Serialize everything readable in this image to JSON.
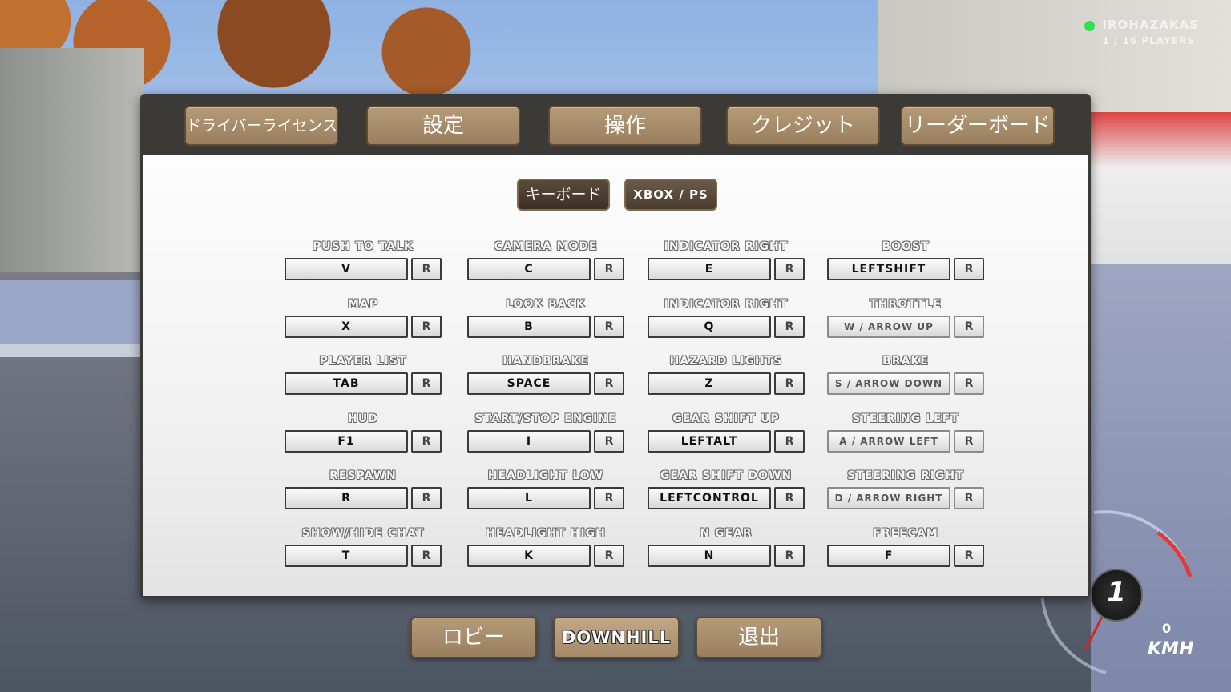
{
  "hud": {
    "server_name": "IROHAZAKAS",
    "players": "1 / 16 PLAYERS",
    "gear": "1",
    "speed": "0",
    "speed_unit": "KMH",
    "status_color": "#2ee04a"
  },
  "tabs": [
    {
      "label": "ドライバーライセンス",
      "active": false
    },
    {
      "label": "設定",
      "active": false
    },
    {
      "label": "操作",
      "active": true
    },
    {
      "label": "クレジット",
      "active": false
    },
    {
      "label": "リーダーボード",
      "active": false
    }
  ],
  "device_toggle": {
    "keyboard": "キーボード",
    "gamepad": "XBOX / PS",
    "selected": "keyboard"
  },
  "reset_label": "R",
  "bindings": [
    [
      {
        "action": "PUSH TO TALK",
        "key": "V"
      },
      {
        "action": "MAP",
        "key": "X"
      },
      {
        "action": "PLAYER LIST",
        "key": "TAB"
      },
      {
        "action": "HUD",
        "key": "F1"
      },
      {
        "action": "RESPAWN",
        "key": "R"
      },
      {
        "action": "SHOW/HIDE CHAT",
        "key": "T"
      }
    ],
    [
      {
        "action": "CAMERA MODE",
        "key": "C"
      },
      {
        "action": "LOOK BACK",
        "key": "B"
      },
      {
        "action": "HANDBRAKE",
        "key": "SPACE"
      },
      {
        "action": "START/STOP ENGINE",
        "key": "I"
      },
      {
        "action": "HEADLIGHT LOW",
        "key": "L"
      },
      {
        "action": "HEADLIGHT HIGH",
        "key": "K"
      }
    ],
    [
      {
        "action": "INDICATOR RIGHT",
        "key": "E"
      },
      {
        "action": "INDICATOR RIGHT",
        "key": "Q"
      },
      {
        "action": "HAZARD LIGHTS",
        "key": "Z"
      },
      {
        "action": "GEAR SHIFT UP",
        "key": "LEFTALT"
      },
      {
        "action": "GEAR SHIFT DOWN",
        "key": "LEFTCONTROL"
      },
      {
        "action": "N GEAR",
        "key": "N"
      }
    ],
    [
      {
        "action": "BOOST",
        "key": "LEFTSHIFT"
      },
      {
        "action": "THROTTLE",
        "key": "W / ARROW UP",
        "dim": true
      },
      {
        "action": "BRAKE",
        "key": "S / ARROW DOWN",
        "dim": true
      },
      {
        "action": "STEERING LEFT",
        "key": "A / ARROW LEFT",
        "dim": true
      },
      {
        "action": "STEERING RIGHT",
        "key": "D / ARROW RIGHT",
        "dim": true
      },
      {
        "action": "FREECAM",
        "key": "F"
      }
    ]
  ],
  "bottom_buttons": {
    "lobby": "ロビー",
    "mode": "DOWNHILL",
    "exit": "退出"
  }
}
